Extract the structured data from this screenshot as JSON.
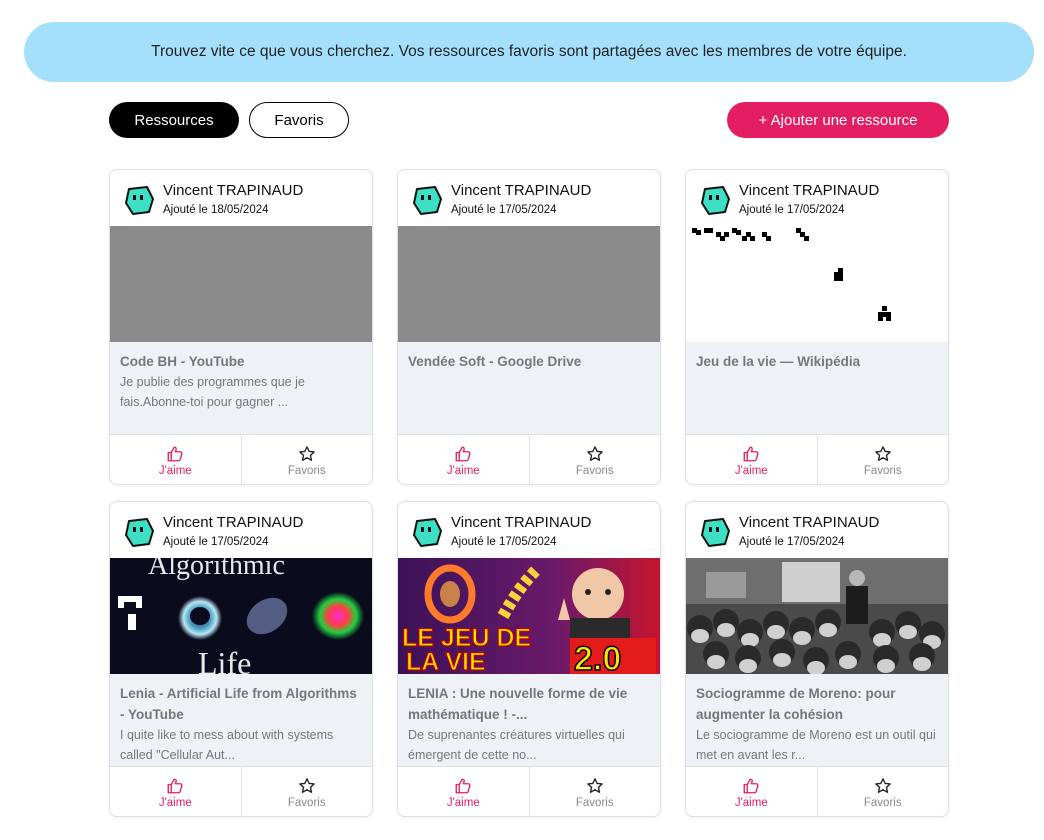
{
  "banner": {
    "text": "Trouvez vite ce que vous cherchez. Vos ressources favoris sont partagées avec les membres de votre équipe."
  },
  "toolbar": {
    "tab_resources": "Ressources",
    "tab_favorites": "Favoris",
    "add_button": "+ Ajouter une ressource"
  },
  "colors": {
    "accent": "#e31e62",
    "banner": "#a4e0fb",
    "avatar": "#3de0c4"
  },
  "cards": [
    {
      "author": "Vincent TRAPINAUD",
      "date": "Ajouté le 18/05/2024",
      "title": "Code BH - YouTube",
      "desc": "Je publie des programmes que je fais.Abonne-toi pour gagner ...",
      "like": "J'aime",
      "fav": "Favoris",
      "thumb": "gray"
    },
    {
      "author": "Vincent TRAPINAUD",
      "date": "Ajouté le 17/05/2024",
      "title": "Vendée Soft - Google Drive",
      "desc": "",
      "like": "J'aime",
      "fav": "Favoris",
      "thumb": "gray"
    },
    {
      "author": "Vincent TRAPINAUD",
      "date": "Ajouté le 17/05/2024",
      "title": "Jeu de la vie — Wikipédia",
      "desc": "",
      "like": "J'aime",
      "fav": "Favoris",
      "thumb": "gliders"
    },
    {
      "author": "Vincent TRAPINAUD",
      "date": "Ajouté le 17/05/2024",
      "title": "Lenia - Artificial Life from Algorithms - YouTube",
      "desc": "I quite like to mess about with systems called \"Cellular Aut...",
      "like": "J'aime",
      "fav": "Favoris",
      "thumb": "lenia",
      "thumb_text_top": "Algorithmic",
      "thumb_text_bottom": "Life"
    },
    {
      "author": "Vincent TRAPINAUD",
      "date": "Ajouté le 17/05/2024",
      "title": "LENIA : Une nouvelle forme de vie mathématique ! -...",
      "desc": "De suprenantes créatures virtuelles qui émergent de cette no...",
      "like": "J'aime",
      "fav": "Favoris",
      "thumb": "jeu",
      "thumb_text_line1": "LE JEU DE",
      "thumb_text_line2": "LA VIE",
      "thumb_text_version": "2.0"
    },
    {
      "author": "Vincent TRAPINAUD",
      "date": "Ajouté le 17/05/2024",
      "title": "Sociogramme de Moreno: pour augmenter la cohésion",
      "desc": "Le sociogramme de Moreno est un outil qui met en avant les r...",
      "like": "J'aime",
      "fav": "Favoris",
      "thumb": "photo"
    }
  ]
}
